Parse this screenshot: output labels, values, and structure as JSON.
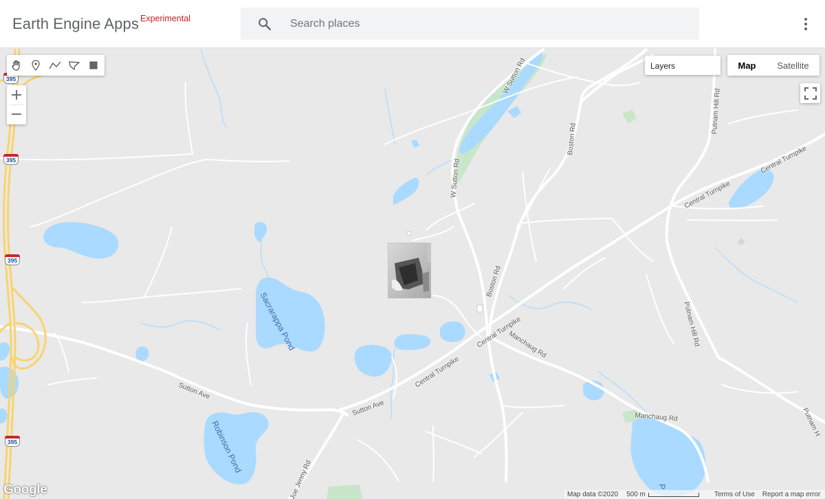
{
  "header": {
    "title": "Earth Engine Apps",
    "badge": "Experimental",
    "search_placeholder": "Search places",
    "search_value": ""
  },
  "toolbar": {
    "tools": [
      "pan-hand-icon",
      "point-marker-icon",
      "line-icon",
      "polygon-icon",
      "rectangle-icon"
    ],
    "zoom_in": "+",
    "zoom_out": "−"
  },
  "layers": {
    "label": "Layers"
  },
  "map_type": {
    "selected": "Map",
    "options": [
      "Map",
      "Satellite"
    ]
  },
  "map": {
    "road_labels": [
      "W Sutton Rd",
      "W Sutton Rd",
      "Boston Rd",
      "Boston Rd",
      "Putnam Hill Rd",
      "Putnam Hill Rd",
      "Central Turnpike",
      "Central Turnpike",
      "Central Turnpike",
      "Central Turnpike",
      "Manchaug Rd",
      "Manchaug Rd",
      "Sutton Ave",
      "Sutton Ave",
      "Joe Jenny Rd",
      "Putnam H",
      "Putnam Hill Rd"
    ],
    "water_labels": [
      "Sacrarappa Pond",
      "Robinson Pond",
      "P"
    ],
    "shields": [
      "395",
      "395",
      "395",
      "395"
    ]
  },
  "footer": {
    "logo": "Google",
    "map_data": "Map data ©2020",
    "scale": "500 m",
    "terms": "Terms of Use",
    "report": "Report a map error"
  },
  "colors": {
    "land": "#e9e9e9",
    "water": "#aadaff",
    "park": "#c8e6c9",
    "road": "#ffffff",
    "highway": "#f9d36b",
    "badge": "#c5221f"
  }
}
